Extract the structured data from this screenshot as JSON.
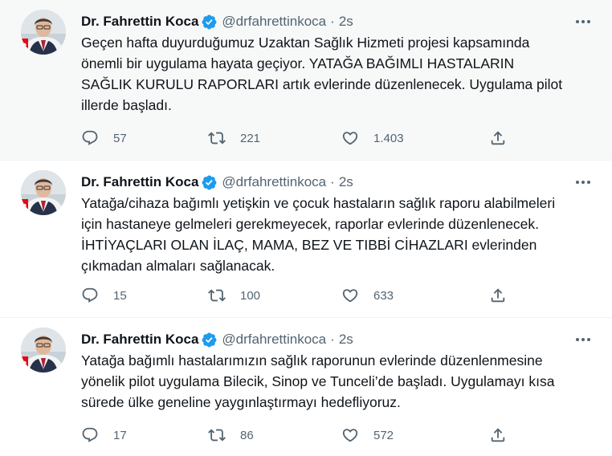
{
  "colors": {
    "text_primary": "#0f1419",
    "text_secondary": "#536471",
    "verified_badge": "#1d9bf0",
    "highlight_background": "#f7f9f9"
  },
  "tweets": [
    {
      "author_name": "Dr. Fahrettin Koca",
      "handle": "@drfahrettinkoca",
      "separator": "·",
      "time": "2s",
      "lines": [
        "Geçen hafta duyurduğumuz Uzaktan Sağlık Hizmeti projesi kapsamında",
        "önemli bir uygulama hayata geçiyor. YATAĞA BAĞIMLI HASTALARIN",
        "SAĞLIK KURULU RAPORLARI artık evlerinde düzenlenecek. Uygulama pilot",
        "illerde başladı."
      ],
      "replies": "57",
      "retweets": "221",
      "likes": "1.403",
      "icons": [
        "reply-icon",
        "retweet-icon",
        "like-icon",
        "share-icon",
        "more-options-icon",
        "verified-badge-icon"
      ]
    },
    {
      "author_name": "Dr. Fahrettin Koca",
      "handle": "@drfahrettinkoca",
      "separator": "·",
      "time": "2s",
      "lines": [
        "Yatağa/cihaza bağımlı yetişkin ve çocuk hastaların sağlık raporu alabilmeleri",
        "için hastaneye gelmeleri gerekmeyecek, raporlar evlerinde düzenlenecek.",
        "İHTİYAÇLARI OLAN İLAÇ, MAMA, BEZ VE TIBBİ CİHAZLARI evlerinden",
        "çıkmadan almaları sağlanacak."
      ],
      "replies": "15",
      "retweets": "100",
      "likes": "633"
    },
    {
      "author_name": "Dr. Fahrettin Koca",
      "handle": "@drfahrettinkoca",
      "separator": "·",
      "time": "2s",
      "lines": [
        "Yatağa bağımlı hastalarımızın sağlık raporunun evlerinde düzenlenmesine",
        "yönelik pilot uygulama Bilecik, Sinop ve Tunceli’de başladı. Uygulamayı kısa",
        "sürede ülke geneline yaygınlaştırmayı hedefliyoruz."
      ],
      "replies": "17",
      "retweets": "86",
      "likes": "572"
    }
  ]
}
